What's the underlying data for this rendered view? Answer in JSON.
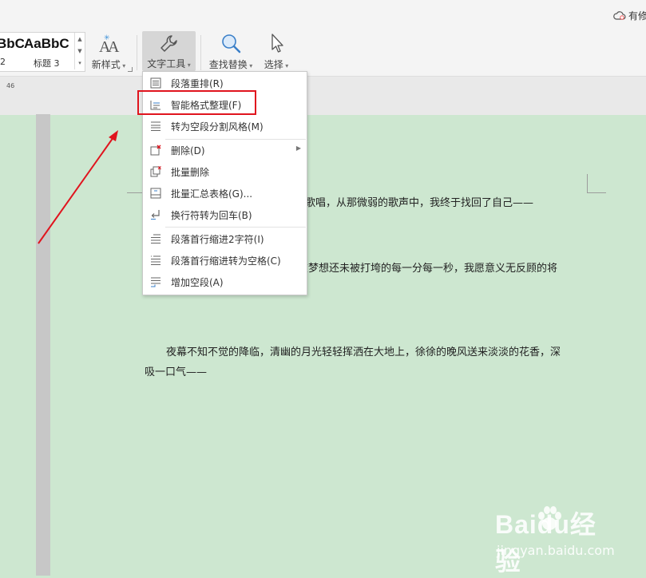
{
  "titlebar": {
    "cloud_status": "有修"
  },
  "style_gallery": {
    "items": [
      {
        "preview": "BbC",
        "name": "2"
      },
      {
        "preview": "AaBbC",
        "name": "标题 3"
      }
    ]
  },
  "toolbar": {
    "new_style": "新样式",
    "text_tools": "文字工具",
    "find_replace": "查找替换",
    "select": "选择"
  },
  "ruler": {
    "marker": "46"
  },
  "text_tools_menu": {
    "items": [
      {
        "label": "段落重排(R)",
        "icon": "paragraph-reflow-icon"
      },
      {
        "label": "智能格式整理(F)",
        "icon": "smart-format-icon",
        "highlighted": true
      },
      {
        "label": "转为空段分割风格(M)",
        "icon": "empty-paragraph-split-icon"
      },
      {
        "label": "删除(D)",
        "icon": "delete-icon",
        "submenu": true
      },
      {
        "label": "批量删除",
        "icon": "batch-delete-icon"
      },
      {
        "label": "批量汇总表格(G)...",
        "icon": "batch-table-icon"
      },
      {
        "label": "换行符转为回车(B)",
        "icon": "line-break-to-enter-icon"
      },
      {
        "label": "段落首行缩进2字符(I)",
        "icon": "first-line-indent-icon"
      },
      {
        "label": "段落首行缩进转为空格(C)",
        "icon": "indent-to-space-icon"
      },
      {
        "label": "增加空段(A)",
        "icon": "add-empty-paragraph-icon"
      }
    ]
  },
  "document": {
    "line1": "声歌唱，从那微弱的歌声中，我终于找回了自己——",
    "line2": "在梦想还未被打垮的每一分每一秒，我愿意义无反顾的将",
    "line3": "夜幕不知不觉的降临，清幽的月光轻轻挥洒在大地上，徐徐的晚风送来淡淡的花香，深",
    "line4": "吸一口气——"
  },
  "watermark": {
    "brand": "Baidu经验",
    "url": "jingyan.baidu.com"
  },
  "colors": {
    "page_background": "#cde7d0",
    "highlight_box": "#e0141e",
    "arrow": "#e0141e",
    "ribbon": "#f4f4f4"
  }
}
